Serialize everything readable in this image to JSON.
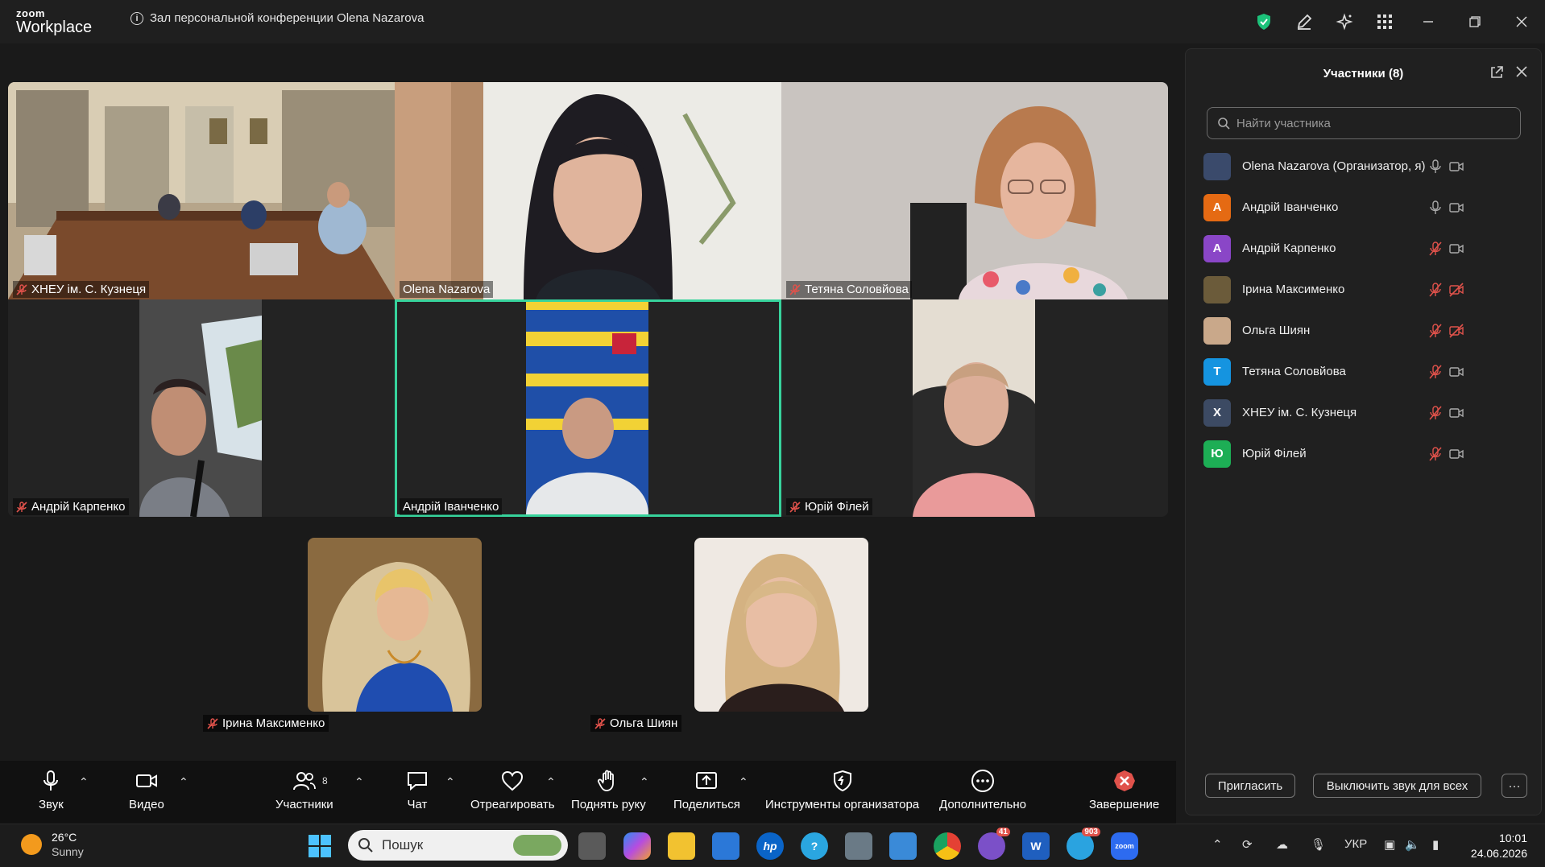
{
  "app": {
    "logo_top": "zoom",
    "logo_bottom": "Workplace",
    "meeting_title": "Зал персональной конференции Olena Nazarova"
  },
  "colors": {
    "active_speaker": "#37d39c",
    "muted_red": "#e0524b",
    "end_red": "#e0524b",
    "shield_green": "#1cc27a"
  },
  "tiles": [
    {
      "name": "ХНЕУ ім. С. Кузнеця",
      "muted": true
    },
    {
      "name": "Olena Nazarova",
      "muted": false
    },
    {
      "name": "Тетяна Соловйова",
      "muted": true
    },
    {
      "name": "Андрій Карпенко",
      "muted": true
    },
    {
      "name": "Андрій Іванченко",
      "muted": false
    },
    {
      "name": "Юрій Філей",
      "muted": true
    },
    {
      "name": "Ірина Максименко",
      "muted": true
    },
    {
      "name": "Ольга Шиян",
      "muted": true
    }
  ],
  "toolbar": {
    "audio": "Звук",
    "video": "Видео",
    "participants": "Участники",
    "participants_count": "8",
    "chat": "Чат",
    "react": "Отреагировать",
    "raise_hand": "Поднять руку",
    "share": "Поделиться",
    "host_tools": "Инструменты организатора",
    "more": "Дополнительно",
    "end": "Завершение"
  },
  "panel": {
    "title": "Участники (8)",
    "search_placeholder": "Найти участника",
    "invite": "Пригласить",
    "mute_all": "Выключить звук для всех",
    "more": "···",
    "participants": [
      {
        "name": "Olena Nazarova (Организатор, я)",
        "initial": "",
        "color": "#3a4a6b",
        "mic": "on",
        "cam": "on"
      },
      {
        "name": "Андрій Іванченко",
        "initial": "А",
        "color": "#e56a13",
        "mic": "on",
        "cam": "on"
      },
      {
        "name": "Андрій Карпенко",
        "initial": "А",
        "color": "#8a46c7",
        "mic": "off",
        "cam": "on"
      },
      {
        "name": "Ірина Максименко",
        "initial": "",
        "color": "#6b5b3a",
        "mic": "off",
        "cam": "off"
      },
      {
        "name": "Ольга Шиян",
        "initial": "",
        "color": "#c9a88a",
        "mic": "off",
        "cam": "off"
      },
      {
        "name": "Тетяна Соловйова",
        "initial": "Т",
        "color": "#1594e0",
        "mic": "off",
        "cam": "on"
      },
      {
        "name": "ХНЕУ ім. С. Кузнеця",
        "initial": "Х",
        "color": "#3c4a63",
        "mic": "off",
        "cam": "on"
      },
      {
        "name": "Юрій Філей",
        "initial": "Ю",
        "color": "#1dae55",
        "mic": "off",
        "cam": "on"
      }
    ]
  },
  "taskbar": {
    "temp": "26°C",
    "weather": "Sunny",
    "search": "Пошук",
    "lang": "УКР",
    "time": "10:01",
    "date": "24.06.2026",
    "viber_badge": "41",
    "telegram_badge": "903"
  }
}
